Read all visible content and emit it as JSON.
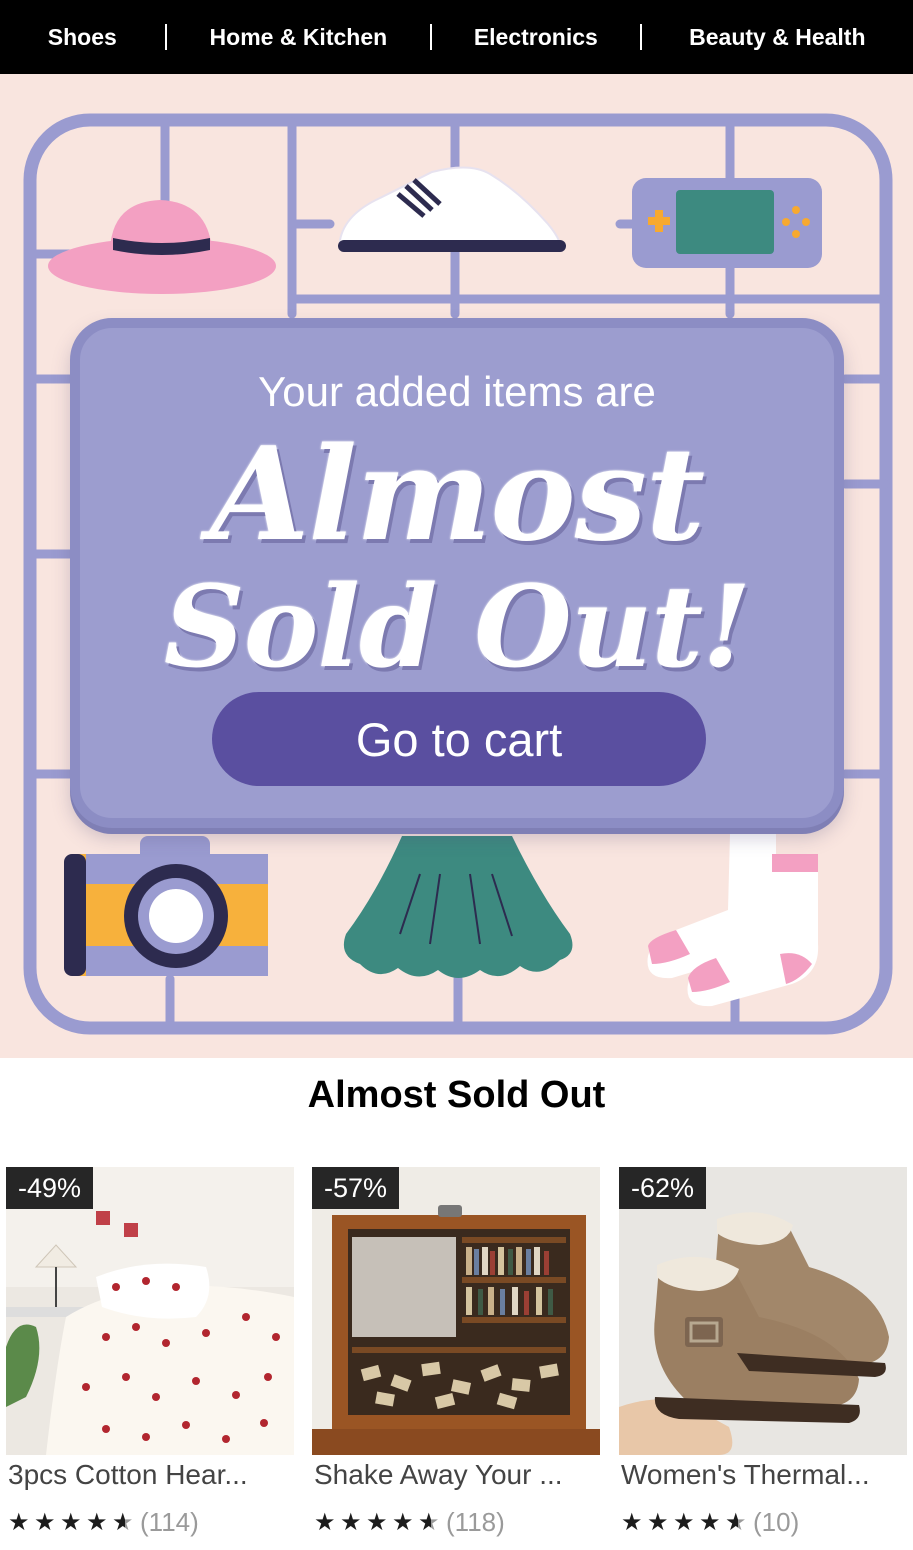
{
  "nav": {
    "items": [
      "Shoes",
      "Home & Kitchen",
      "Electronics",
      "Beauty & Health"
    ]
  },
  "hero": {
    "subtitle": "Your added items are",
    "headline_line1": "Almost",
    "headline_line2": "Sold Out!",
    "cta_label": "Go to cart",
    "icons": [
      "hat-icon",
      "sneaker-icon",
      "game-console-icon",
      "camera-icon",
      "dress-icon",
      "socks-icon"
    ]
  },
  "section": {
    "title": "Almost Sold Out"
  },
  "products": [
    {
      "badge": "-49%",
      "title": "3pcs Cotton Hear...",
      "rating": 4.5,
      "reviews": "(114)"
    },
    {
      "badge": "-57%",
      "title": "Shake Away Your ...",
      "rating": 4.5,
      "reviews": "(118)"
    },
    {
      "badge": "-62%",
      "title": "Women's Thermal...",
      "rating": 4.5,
      "reviews": "(10)"
    }
  ],
  "colors": {
    "nav_bg": "#000000",
    "hero_bg": "#f9e5df",
    "frame": "#9a9bd0",
    "panel": "#9c9dcf",
    "cta": "#5a4fa0",
    "badge_bg": "#262626"
  }
}
